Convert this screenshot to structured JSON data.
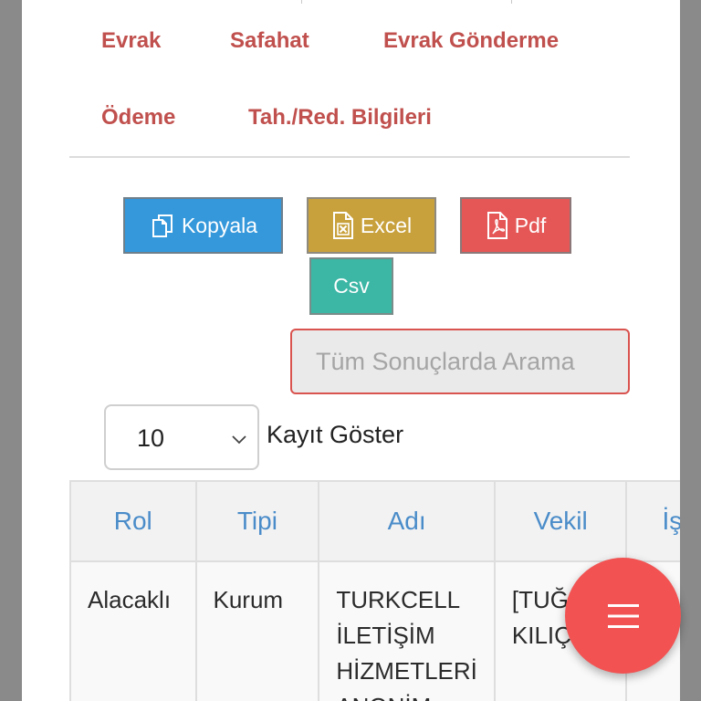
{
  "tabs_row1": [
    "Evrak",
    "Safahat",
    "Evrak Gönderme"
  ],
  "tabs_row2": [
    "Ödeme",
    "Tah./Red. Bilgileri"
  ],
  "export_buttons": {
    "copy": {
      "label": "Kopyala",
      "icon": "copy-icon",
      "color": "#3498db"
    },
    "excel": {
      "label": "Excel",
      "icon": "excel-file-icon",
      "color": "#c8a13d"
    },
    "pdf": {
      "label": "Pdf",
      "icon": "pdf-file-icon",
      "color": "#e55757"
    },
    "csv": {
      "label": "Csv",
      "color": "#3cb6a5"
    }
  },
  "search": {
    "placeholder": "Tüm Sonuçlarda Arama",
    "value": ""
  },
  "page_length": {
    "selected": "10",
    "label": "Kayıt Göster"
  },
  "table": {
    "headers": [
      "Rol",
      "Tipi",
      "Adı",
      "Vekil",
      "İşle"
    ],
    "rows": [
      {
        "rol": "Alacaklı",
        "tipi": "Kurum",
        "adi": "TURKCELL İLETİŞİM HİZMETLERİ ANONİM",
        "vekil": "[TUĞ KILIÇ",
        "islem": ""
      }
    ]
  },
  "fab": {
    "icon": "hamburger-menu-icon",
    "color": "#f25252"
  }
}
